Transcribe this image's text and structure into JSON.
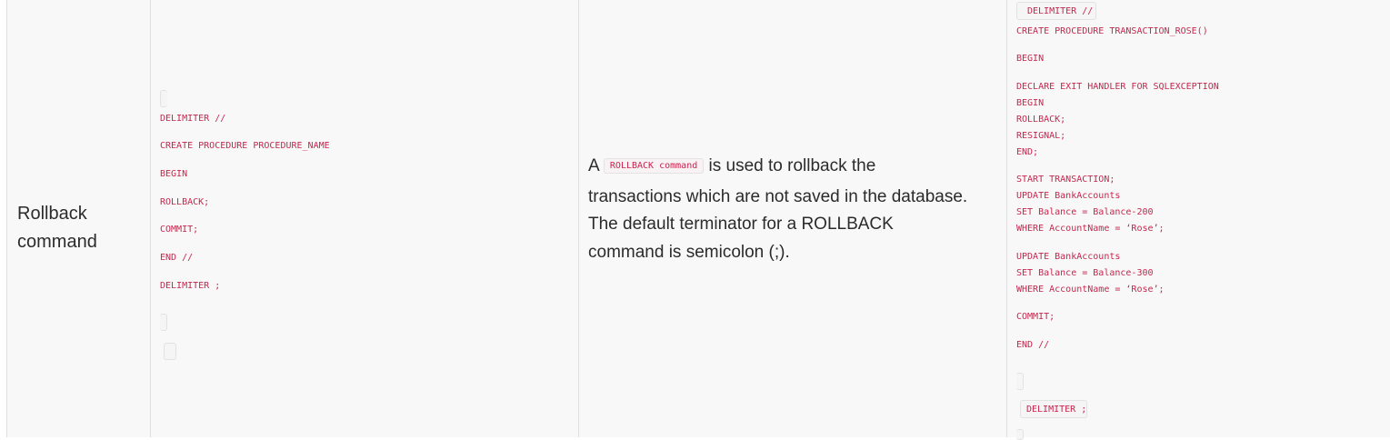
{
  "row": {
    "command_name": "Rollback command",
    "syntax": {
      "lines": [
        "DELIMITER //",
        "CREATE PROCEDURE PROCEDURE_NAME",
        "BEGIN",
        "ROLLBACK;",
        "COMMIT;",
        "END //",
        "DELIMITER ;"
      ]
    },
    "description": {
      "prefix": "A",
      "inline_code": "ROLLBACK command",
      "suffix": "is used to rollback the transactions which are not saved in the database.",
      "line2": "The default terminator for a ROLLBACK command is semicolon (;)."
    },
    "example": {
      "top_chip": "DELIMITER //",
      "lines": [
        "CREATE PROCEDURE TRANSACTION_ROSE()",
        "BEGIN",
        "DECLARE EXIT HANDLER FOR SQLEXCEPTION",
        "BEGIN",
        "ROLLBACK;",
        "RESIGNAL;",
        "END;",
        "START TRANSACTION;",
        "UPDATE BankAccounts",
        "SET Balance = Balance-200",
        "WHERE AccountName = ‘Rose’;",
        "UPDATE BankAccounts",
        "SET Balance = Balance-300",
        "WHERE AccountName = ‘Rose’;",
        "COMMIT;",
        "END //"
      ],
      "bottom_chip": "DELIMITER ;"
    }
  }
}
